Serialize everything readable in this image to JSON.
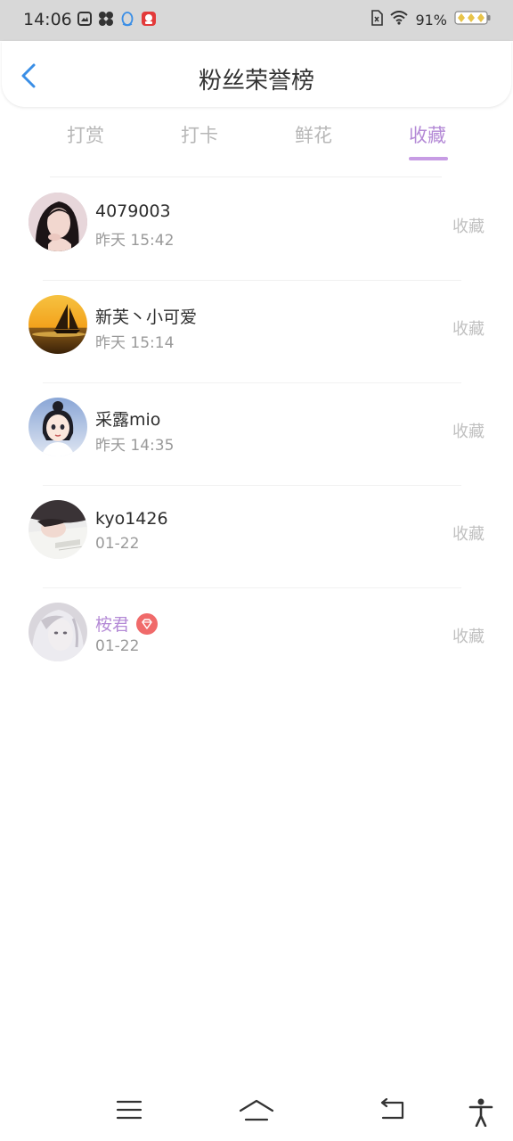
{
  "status_bar": {
    "time": "14:06",
    "battery_percent": "91%",
    "notification_icons": [
      "gallery-icon",
      "app-icon",
      "qq-icon",
      "red-app-icon"
    ],
    "right_icons": [
      "sim-icon",
      "wifi-icon",
      "battery-icon"
    ]
  },
  "header": {
    "title": "粉丝荣誉榜",
    "back_icon": "chevron-left-icon"
  },
  "tabs": {
    "items": [
      {
        "label": "打赏"
      },
      {
        "label": "打卡"
      },
      {
        "label": "鲜花"
      },
      {
        "label": "收藏"
      }
    ],
    "active_index": 3
  },
  "list": {
    "rows": [
      {
        "name": "4079003",
        "time": "昨天 15:42",
        "action": "收藏",
        "avatar": "portrait-woman"
      },
      {
        "name": "新芙丶小可爱",
        "time": "昨天 15:14",
        "action": "收藏",
        "avatar": "sunset-sailboat"
      },
      {
        "name": "采露mio",
        "time": "昨天 14:35",
        "action": "收藏",
        "avatar": "anime-girl"
      },
      {
        "name": "kyo1426",
        "time": "01-22",
        "action": "收藏",
        "avatar": "girl-lying-down"
      },
      {
        "name": "桉君",
        "time": "01-22",
        "action": "收藏",
        "avatar": "pale-portrait",
        "vip": true
      }
    ]
  },
  "colors": {
    "accent": "#b48ad6",
    "vip_badge": "#f06a6a",
    "back_arrow": "#3a8ee6"
  },
  "navbar": {
    "icons": [
      "menu-icon",
      "home-icon",
      "back-icon",
      "accessibility-icon"
    ]
  }
}
